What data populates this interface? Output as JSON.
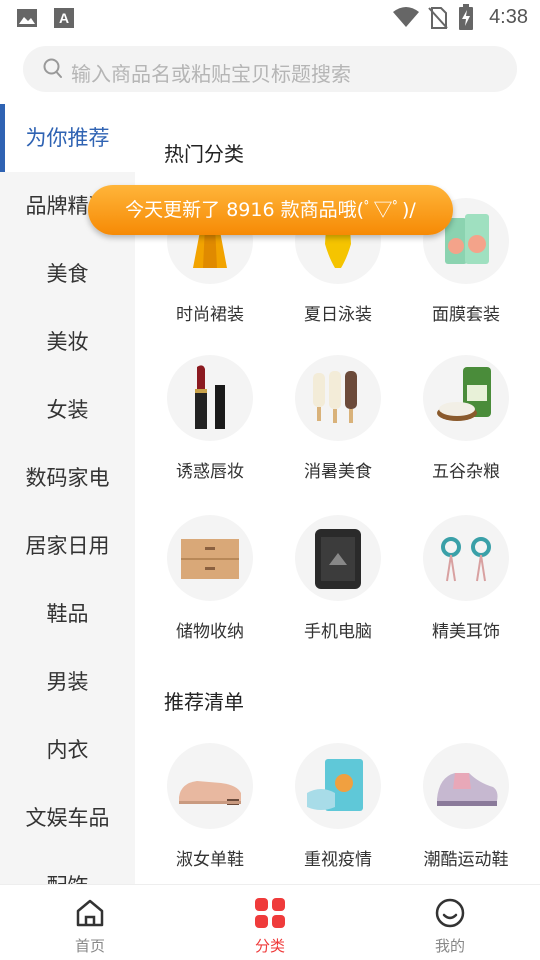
{
  "status_bar": {
    "time": "4:38",
    "left_icons": [
      "image-icon",
      "font-a-icon"
    ],
    "right_icons": [
      "wifi-icon",
      "no-sim-icon",
      "battery-charging-icon"
    ]
  },
  "search": {
    "placeholder": "输入商品名或粘贴宝贝标题搜索"
  },
  "sidebar": {
    "active_color": "#2f63b3",
    "items": [
      {
        "label": "为你推荐",
        "active": true
      },
      {
        "label": "品牌精选"
      },
      {
        "label": "美食"
      },
      {
        "label": "美妆"
      },
      {
        "label": "女装"
      },
      {
        "label": "数码家电"
      },
      {
        "label": "居家日用"
      },
      {
        "label": "鞋品"
      },
      {
        "label": "男装"
      },
      {
        "label": "内衣"
      },
      {
        "label": "文娱车品"
      },
      {
        "label": "配饰"
      }
    ]
  },
  "sections": [
    {
      "title": "热门分类",
      "items": [
        {
          "label": "时尚裙装",
          "icon": "dress-icon"
        },
        {
          "label": "夏日泳装",
          "icon": "swimsuit-icon"
        },
        {
          "label": "面膜套装",
          "icon": "face-mask-icon"
        },
        {
          "label": "诱惑唇妆",
          "icon": "lipstick-icon"
        },
        {
          "label": "消暑美食",
          "icon": "popsicle-icon"
        },
        {
          "label": "五谷杂粮",
          "icon": "rice-icon"
        },
        {
          "label": "储物收纳",
          "icon": "storage-drawer-icon"
        },
        {
          "label": "手机电脑",
          "icon": "rugged-phone-icon"
        },
        {
          "label": "精美耳饰",
          "icon": "earrings-icon"
        }
      ]
    },
    {
      "title": "推荐清单",
      "items": [
        {
          "label": "淑女单鞋",
          "icon": "loafer-icon"
        },
        {
          "label": "重视疫情",
          "icon": "medical-mask-icon"
        },
        {
          "label": "潮酷运动鞋",
          "icon": "sneaker-icon"
        }
      ]
    }
  ],
  "toast": {
    "text": "今天更新了 8916 款商品哦(ﾟ▽ﾟ)/"
  },
  "tabbar": {
    "active_color": "#ef3b3b",
    "items": [
      {
        "label": "首页",
        "icon": "home-icon"
      },
      {
        "label": "分类",
        "icon": "category-grid-icon",
        "active": true
      },
      {
        "label": "我的",
        "icon": "profile-face-icon"
      }
    ]
  }
}
